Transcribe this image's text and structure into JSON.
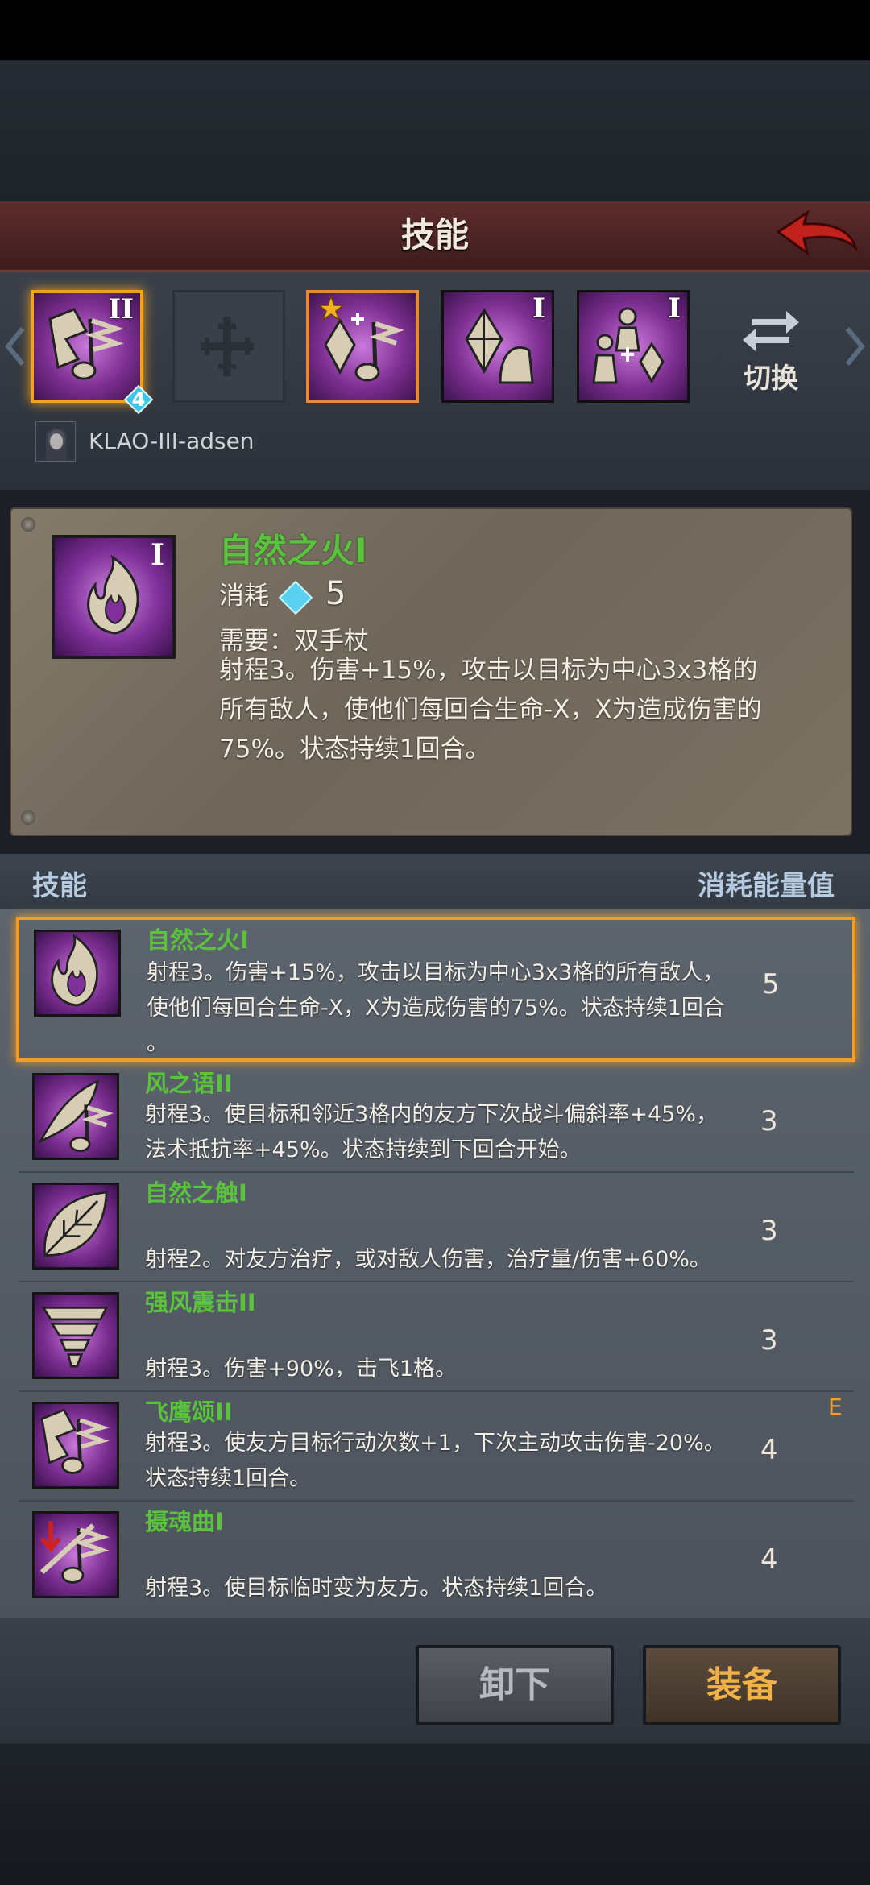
{
  "header": {
    "title": "技能"
  },
  "slots": [
    {
      "icon": "music-note-feather-icon",
      "rank": "II",
      "badge": "4",
      "selected": true
    },
    {
      "icon": "empty-cross-slot-icon",
      "rank": "",
      "empty": true
    },
    {
      "icon": "crystal-music-icon",
      "rank": "",
      "star": true,
      "orange": true
    },
    {
      "icon": "crystal-hand-icon",
      "rank": "I"
    },
    {
      "icon": "party-crystal-icon",
      "rank": "I"
    }
  ],
  "switch": {
    "label": "切换"
  },
  "character": {
    "name": "KLAO-III-adsen"
  },
  "detail": {
    "name": "自然之火I",
    "rank": "I",
    "cost_label": "消耗",
    "cost_value": "5",
    "require": "需要：双手杖",
    "description": "射程3。伤害+15%，攻击以目标为中心3x3格的所有敌人，使他们每回合生命-X，X为造成伤害的75%。状态持续1回合。"
  },
  "list_header": {
    "left": "技能",
    "right": "消耗能量值"
  },
  "skills": [
    {
      "name": "自然之火I",
      "icon": "flame-icon",
      "desc_lines": [
        "射程3。伤害+15%，攻击以目标为中心3x3格的所有敌人，",
        "使他们每回合生命-X，X为造成伤害的75%。状态持续1回合",
        "。"
      ],
      "cost": "5",
      "selected": true
    },
    {
      "name": "风之语II",
      "icon": "feather-music-icon",
      "desc_lines": [
        "射程3。使目标和邻近3格内的友方下次战斗偏斜率+45%，",
        "法术抵抗率+45%。状态持续到下回合开始。"
      ],
      "cost": "3"
    },
    {
      "name": "自然之触I",
      "icon": "leaf-icon",
      "desc_lines": [
        "",
        "射程2。对友方治疗，或对敌人伤害，治疗量/伤害+60%。"
      ],
      "cost": "3"
    },
    {
      "name": "强风震击II",
      "icon": "tornado-icon",
      "desc_lines": [
        "",
        "射程3。伤害+90%，击飞1格。"
      ],
      "cost": "3"
    },
    {
      "name": "飞鹰颂II",
      "icon": "music-note-feather-icon",
      "desc_lines": [
        "射程3。使友方目标行动次数+1，下次主动攻击伤害-20%。",
        "状态持续1回合。"
      ],
      "cost": "4"
    },
    {
      "name": "摄魂曲I",
      "icon": "cursed-music-icon",
      "desc_lines": [
        "",
        "射程3。使目标临时变为友方。状态持续1回合。"
      ],
      "cost": "4"
    }
  ],
  "side_marker": "E",
  "buttons": {
    "unequip": "卸下",
    "equip": "装备"
  }
}
